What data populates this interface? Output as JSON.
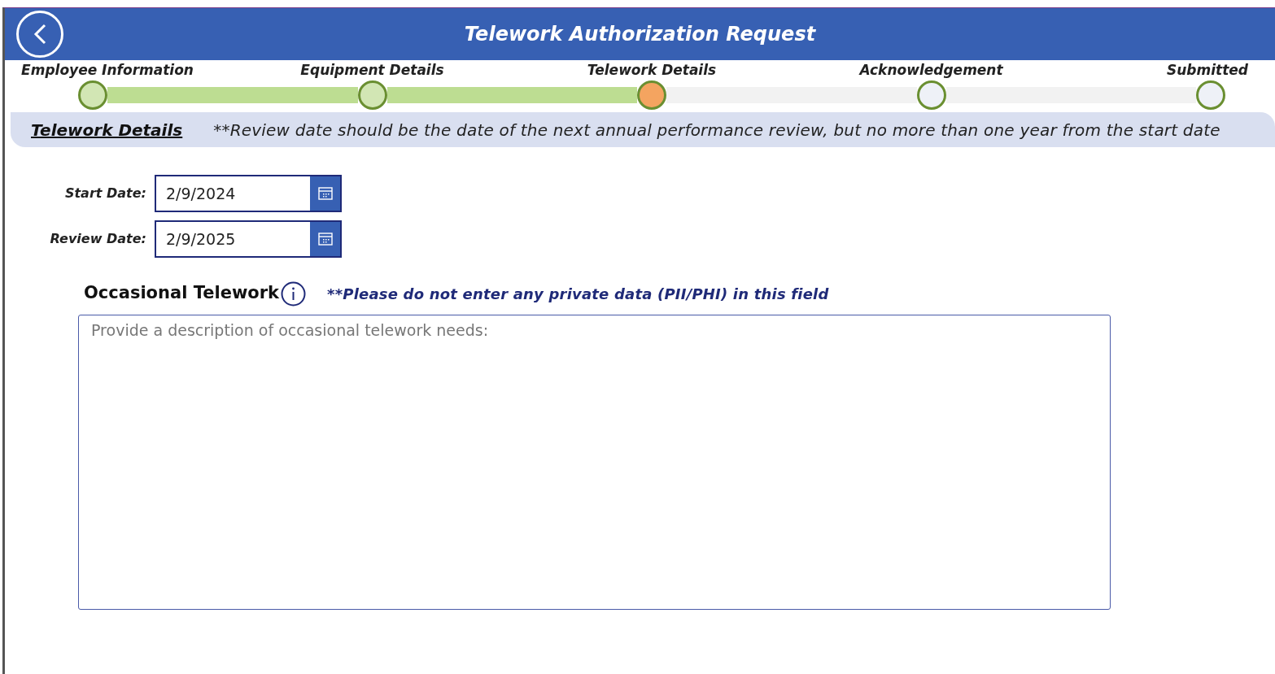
{
  "header": {
    "title": "Telework Authorization Request"
  },
  "steps": [
    {
      "label": "Employee Information",
      "kind": "complete"
    },
    {
      "label": "Equipment Details",
      "kind": "complete"
    },
    {
      "label": "Telework Details",
      "kind": "current"
    },
    {
      "label": "Acknowledgement",
      "kind": "pending"
    },
    {
      "label": "Submitted",
      "kind": "pending"
    }
  ],
  "section": {
    "title": "Telework Details",
    "note": "**Review date should be the date of the next annual performance review, but no more than one year from the start date"
  },
  "dates": [
    {
      "label": "Start Date:",
      "value": "2/9/2024"
    },
    {
      "label": "Review Date:",
      "value": "2/9/2025"
    }
  ],
  "occasional": {
    "title": "Occasional Telework",
    "note": "**Please do not enter any private data (PII/PHI) in this field",
    "placeholder": "Provide a description of occasional telework needs:"
  }
}
